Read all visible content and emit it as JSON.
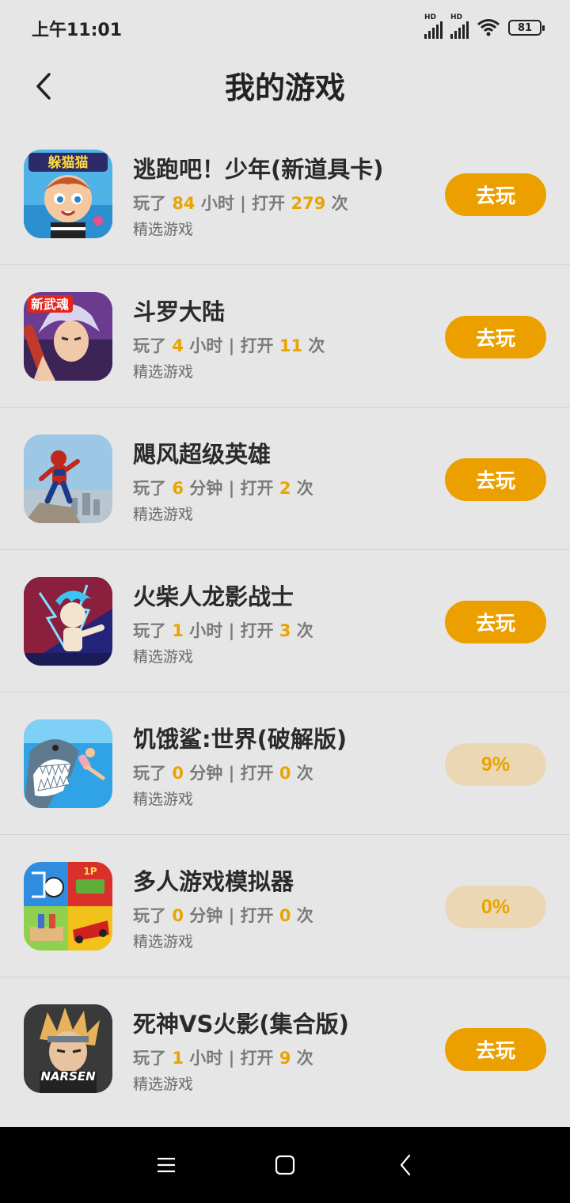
{
  "status_bar": {
    "time": "上午11:01",
    "battery": "81",
    "signal_label": "HD"
  },
  "header": {
    "title": "我的游戏"
  },
  "games": [
    {
      "name": "逃跑吧！少年(新道具卡)",
      "played_prefix": "玩了",
      "played_value": "84",
      "played_unit": "小时",
      "sep": "|",
      "open_prefix": "打开",
      "open_value": "279",
      "open_unit": "次",
      "category": "精选游戏",
      "button": "去玩",
      "icon": "cartoon-boy-icon",
      "icon_text": "躲猫猫"
    },
    {
      "name": "斗罗大陆",
      "played_prefix": "玩了",
      "played_value": "4",
      "played_unit": "小时",
      "sep": "|",
      "open_prefix": "打开",
      "open_value": "11",
      "open_unit": "次",
      "category": "精选游戏",
      "button": "去玩",
      "icon": "anime-hero-icon",
      "icon_text": "新武魂"
    },
    {
      "name": "飓风超级英雄",
      "played_prefix": "玩了",
      "played_value": "6",
      "played_unit": "分钟",
      "sep": "|",
      "open_prefix": "打开",
      "open_value": "2",
      "open_unit": "次",
      "category": "精选游戏",
      "button": "去玩",
      "icon": "spider-hero-icon"
    },
    {
      "name": "火柴人龙影战士",
      "played_prefix": "玩了",
      "played_value": "1",
      "played_unit": "小时",
      "sep": "|",
      "open_prefix": "打开",
      "open_value": "3",
      "open_unit": "次",
      "category": "精选游戏",
      "button": "去玩",
      "icon": "stickman-warrior-icon"
    },
    {
      "name": "饥饿鲨:世界(破解版)",
      "played_prefix": "玩了",
      "played_value": "0",
      "played_unit": "分钟",
      "sep": "|",
      "open_prefix": "打开",
      "open_value": "0",
      "open_unit": "次",
      "category": "精选游戏",
      "button": "9%",
      "button_state": "downloading",
      "icon": "shark-icon"
    },
    {
      "name": "多人游戏模拟器",
      "played_prefix": "玩了",
      "played_value": "0",
      "played_unit": "分钟",
      "sep": "|",
      "open_prefix": "打开",
      "open_value": "0",
      "open_unit": "次",
      "category": "精选游戏",
      "button": "0%",
      "button_state": "downloading",
      "icon": "minigames-grid-icon"
    },
    {
      "name": "死神VS火影(集合版)",
      "played_prefix": "玩了",
      "played_value": "1",
      "played_unit": "小时",
      "sep": "|",
      "open_prefix": "打开",
      "open_value": "9",
      "open_unit": "次",
      "category": "精选游戏",
      "button": "去玩",
      "icon": "ninja-icon",
      "icon_text": "NARSEN"
    }
  ],
  "colors": {
    "accent": "#eba000",
    "accent_light": "#ecd7b4",
    "background": "#e6e6e6",
    "nav_bar": "#000000"
  },
  "nav": {
    "items": [
      "menu-icon",
      "home-icon",
      "back-icon"
    ]
  }
}
